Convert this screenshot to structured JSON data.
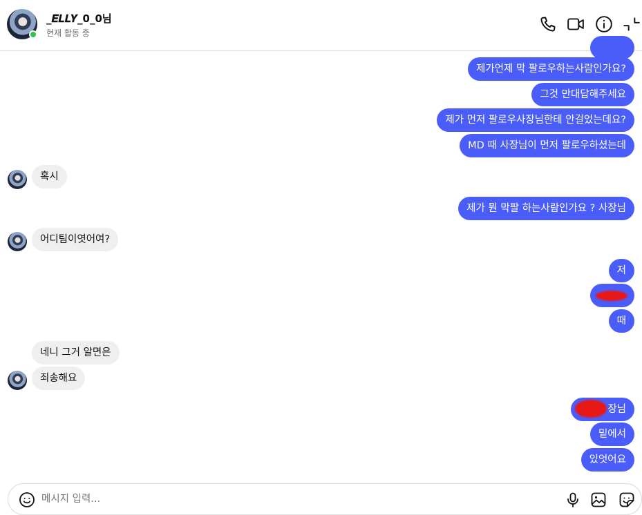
{
  "header": {
    "username": "_𝑬𝑳𝑳𝒀_0_0님",
    "status": "현재 활동 중",
    "icons": [
      "phone-icon",
      "video-icon",
      "info-icon",
      "minimize-icon"
    ]
  },
  "messages": [
    {
      "side": "out",
      "text": "제가언제 막 팔로우하는사람인가요?"
    },
    {
      "side": "out",
      "text": "그것 만대답해주세요"
    },
    {
      "side": "out",
      "text": "제가 먼저 팔로우사장님한테 안걸었는데요?"
    },
    {
      "side": "out",
      "text": "MD 때 사장님이 먼저 팔로우하셨는데"
    },
    {
      "side": "in",
      "text": "혹시"
    },
    {
      "side": "out",
      "text": "제가 뭔 막팔 하는사람인가요 ? 사장님"
    },
    {
      "side": "in",
      "text": "어디팀이엿어여?"
    },
    {
      "side": "out",
      "text": "저"
    },
    {
      "side": "out",
      "text": ""
    },
    {
      "side": "out",
      "text": "때"
    },
    {
      "side": "in",
      "text": "네니 그거 알면은"
    },
    {
      "side": "in",
      "text": "죄송해요"
    },
    {
      "side": "out",
      "text": "장님"
    },
    {
      "side": "out",
      "text": "밑에서"
    },
    {
      "side": "out",
      "text": "있엇어요"
    }
  ],
  "composer": {
    "placeholder": "메시지 입력...",
    "icons": [
      "emoji-icon",
      "microphone-icon",
      "image-icon",
      "sticker-icon"
    ]
  },
  "colors": {
    "outgoing_bubble": "#4a5df9",
    "incoming_bubble": "#efefef",
    "online": "#31c44f",
    "redaction": "#e81818"
  }
}
